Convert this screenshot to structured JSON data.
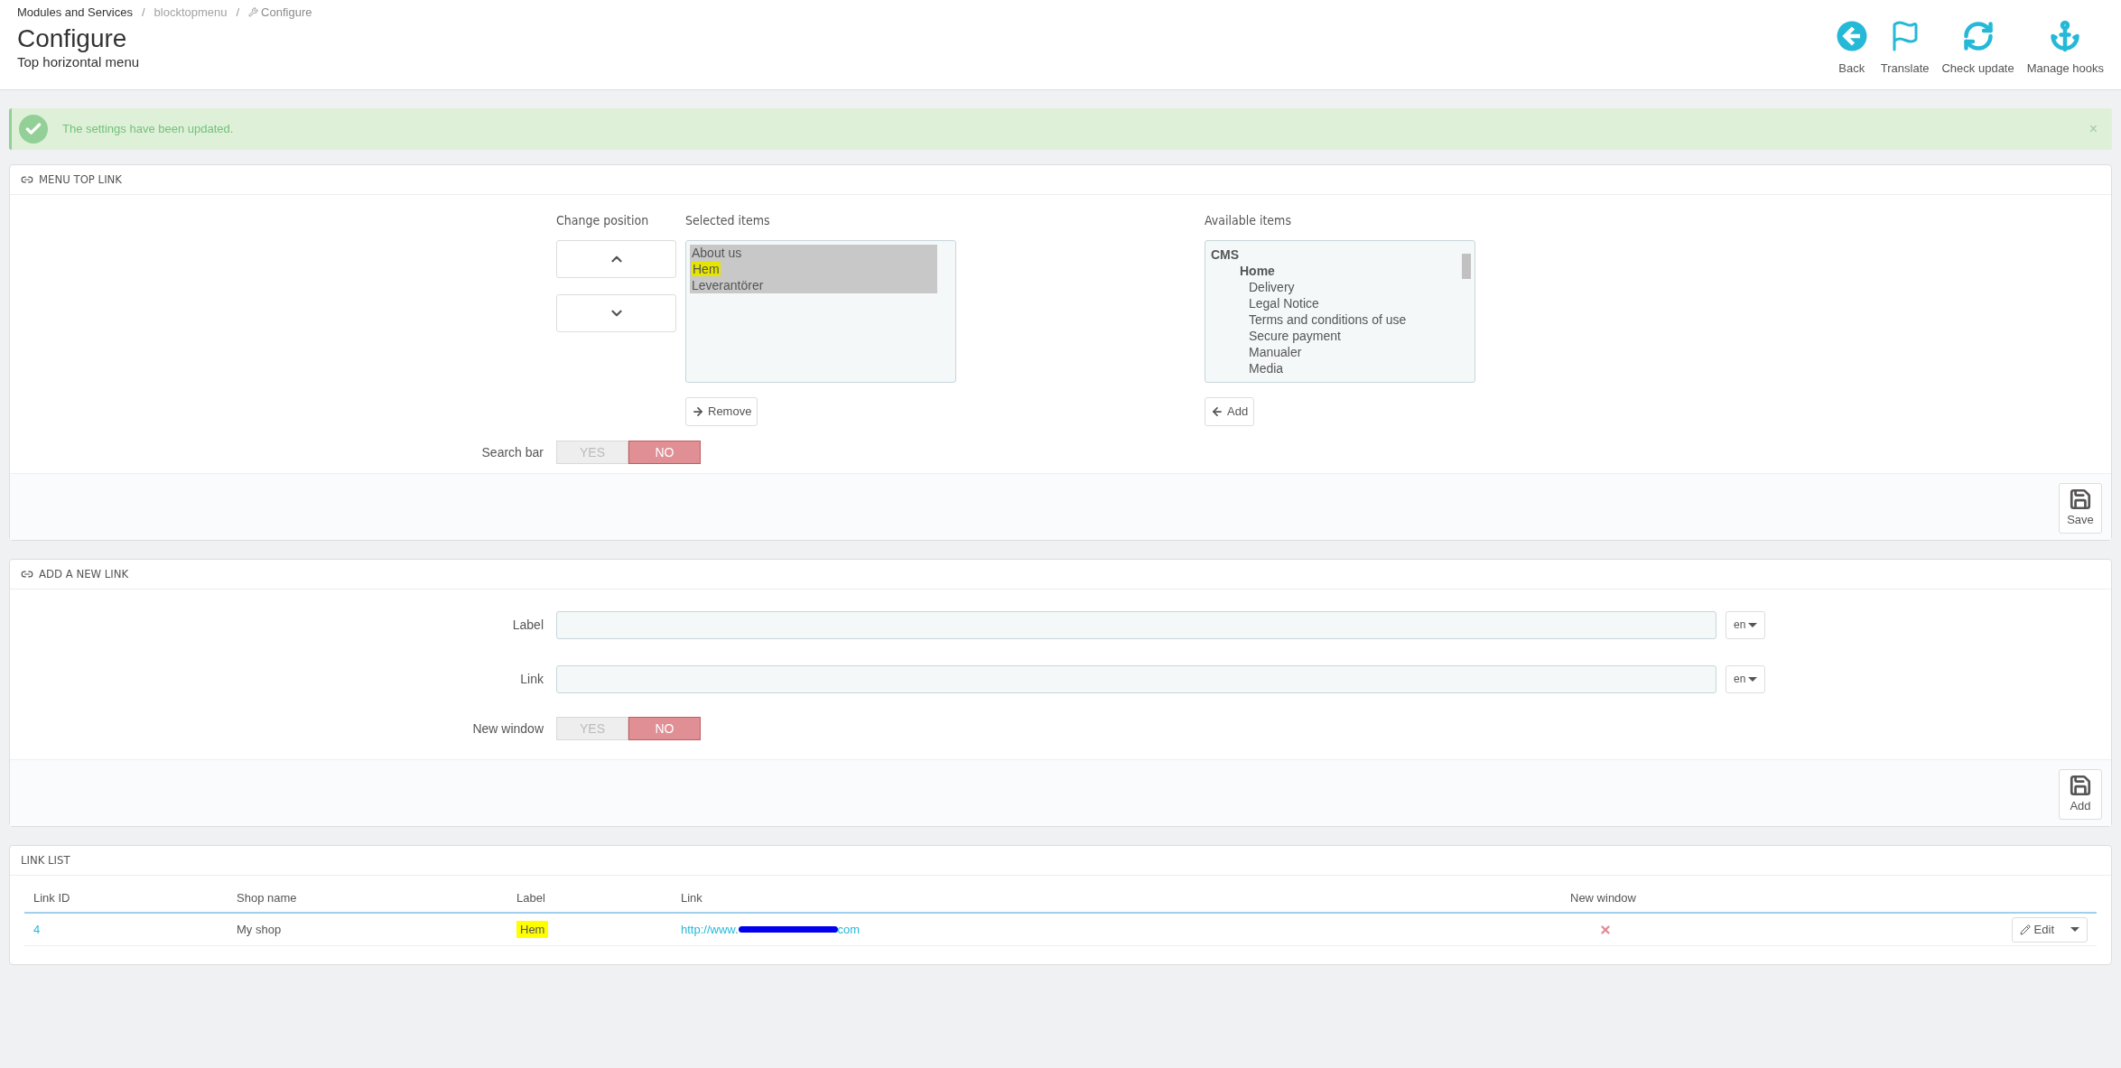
{
  "breadcrumb": [
    {
      "label": "Modules and Services",
      "current": false
    },
    {
      "separator_before": "/",
      "label": "blocktopmenu",
      "current": false
    },
    {
      "separator_before": "/",
      "label": "Configure",
      "current": true
    }
  ],
  "page_title": "Configure",
  "page_subtitle": "Top horizontal menu",
  "toolbar": [
    {
      "kind": "back",
      "label": "Back"
    },
    {
      "kind": "translate",
      "label": "Translate"
    },
    {
      "kind": "update",
      "label": "Check update"
    },
    {
      "kind": "hooks",
      "label": "Manage hooks"
    }
  ],
  "alert": {
    "message": "The settings have been updated.",
    "close": "×"
  },
  "menu_top_link": {
    "title": "MENU TOP LINK",
    "change_position_label": "Change position",
    "selected_label": "Selected items",
    "selected_items": [
      {
        "label": "About us",
        "selected": true,
        "highlighted": false
      },
      {
        "label": "Hem",
        "selected": true,
        "highlighted": true
      },
      {
        "label": "Leverantörer",
        "selected": true,
        "highlighted": false
      }
    ],
    "remove_button": "Remove",
    "available_label": "Available items",
    "available_items": [
      {
        "label": "CMS",
        "children": [
          {
            "label": "Home",
            "children": [
              {
                "label": "Delivery"
              },
              {
                "label": "Legal Notice"
              },
              {
                "label": "Terms and conditions of use"
              },
              {
                "label": "Secure payment"
              },
              {
                "label": "Manualer"
              },
              {
                "label": "Media"
              }
            ]
          }
        ]
      }
    ],
    "add_button": "Add",
    "search_bar": {
      "label": "Search bar",
      "options": [
        {
          "label": "YES",
          "selected": false
        },
        {
          "label": "NO",
          "selected": true
        }
      ]
    },
    "save_button": "Save"
  },
  "add_new_link": {
    "title": "ADD A NEW LINK",
    "fields": [
      {
        "label": "Label",
        "language": "en"
      },
      {
        "label": "Link",
        "language": "en"
      }
    ],
    "new_window": {
      "label": "New window",
      "options": [
        {
          "label": "YES",
          "selected": false
        },
        {
          "label": "NO",
          "selected": true
        }
      ]
    },
    "add_button": "Add"
  },
  "link_list": {
    "title": "LINK LIST",
    "columns": [
      "Link ID",
      "Shop name",
      "Label",
      "Link",
      "New window"
    ],
    "rows": [
      {
        "link_id": "4",
        "shop_name": "My shop",
        "label": "Hem",
        "label_highlighted": true,
        "link_prefix": "http://www.",
        "link_redacted": true,
        "link_suffix": "com",
        "new_window": false,
        "edit_button": "Edit"
      }
    ]
  }
}
